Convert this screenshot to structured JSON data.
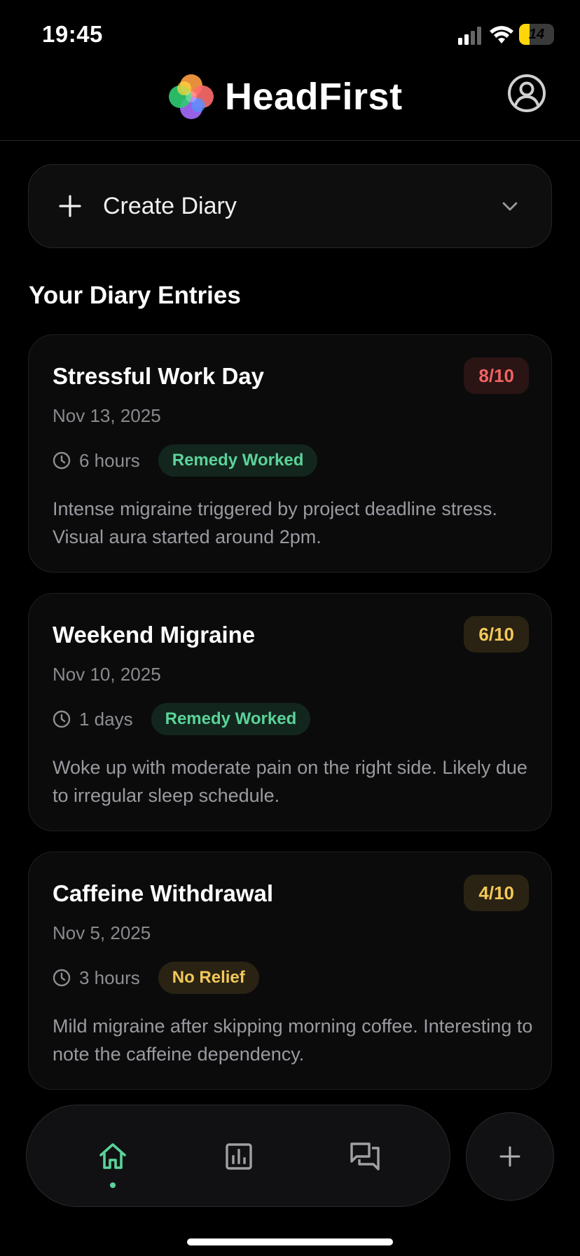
{
  "status_bar": {
    "time": "19:45",
    "battery_level": "14",
    "battery_fraction": 0.14,
    "icons": [
      "signal-icon",
      "wifi-icon",
      "battery-icon"
    ]
  },
  "header": {
    "app_title": "HeadFirst",
    "logo_icon": "flower-logo-icon",
    "profile_icon": "user-circle-icon"
  },
  "create_diary": {
    "label": "Create Diary",
    "icon": "plus-icon",
    "chevron_icon": "chevron-down-icon"
  },
  "section_title": "Your Diary Entries",
  "entries": [
    {
      "title": "Stressful Work Day",
      "severity": "8/10",
      "date": "Nov 13, 2025",
      "duration": "6 hours",
      "status": "Remedy Worked",
      "description": "Intense migraine triggered by project deadline stress. Visual aura started around 2pm."
    },
    {
      "title": "Weekend Migraine",
      "severity": "6/10",
      "date": "Nov 10, 2025",
      "duration": "1 days",
      "status": "Remedy Worked",
      "description": "Woke up with moderate pain on the right side. Likely due to irregular sleep schedule."
    },
    {
      "title": "Caffeine Withdrawal",
      "severity": "4/10",
      "date": "Nov 5, 2025",
      "duration": "3 hours",
      "status": "No Relief",
      "description": "Mild migraine after skipping morning coffee. Interesting to note the caffeine dependency."
    }
  ],
  "bottom_nav": {
    "items": [
      "home-icon",
      "bar-chart-icon",
      "chat-bubbles-icon"
    ],
    "active": "home-icon",
    "fab_icon": "plus-icon"
  },
  "colors": {
    "accent": "#5bd39a",
    "severity_high": "#f06262",
    "severity_mid": "#f3c85a",
    "background": "#000000",
    "card": "#0b0b0c"
  }
}
